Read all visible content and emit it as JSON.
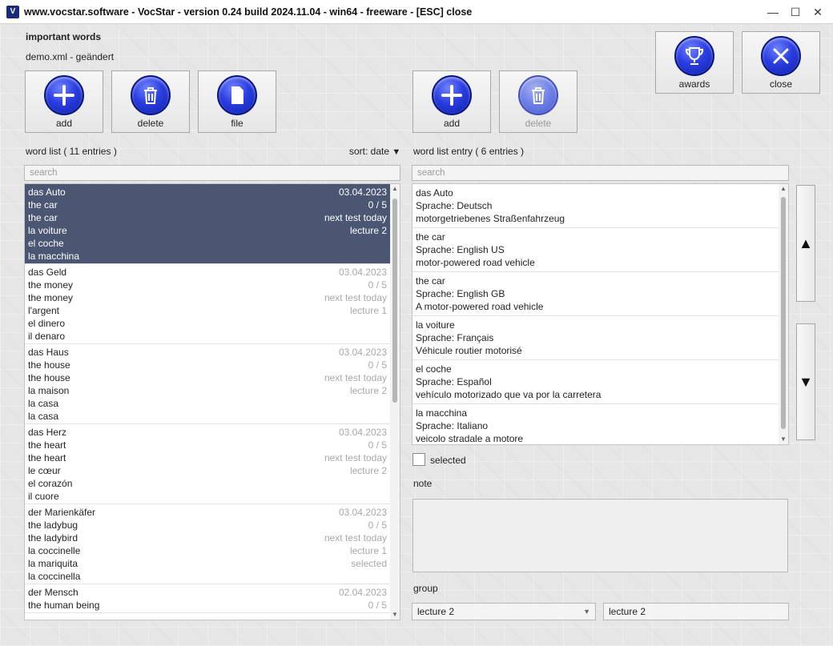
{
  "window": {
    "title": "www.vocstar.software - VocStar - version 0.24 build 2024.11.04 - win64 - freeware - [ESC] close",
    "app_icon": "vocstar-logo",
    "controls": {
      "minimize": "—",
      "maximize": "☐",
      "close": "✕"
    }
  },
  "header": {
    "heading": "important words",
    "file_status": "demo.xml - geändert"
  },
  "toolbar_left": [
    {
      "name": "add-list-button",
      "label": "add",
      "icon": "plus-icon",
      "enabled": true
    },
    {
      "name": "delete-list-button",
      "label": "delete",
      "icon": "trash-icon",
      "enabled": true
    },
    {
      "name": "file-button",
      "label": "file",
      "icon": "file-icon",
      "enabled": true
    }
  ],
  "toolbar_right": [
    {
      "name": "add-entry-button",
      "label": "add",
      "icon": "plus-icon",
      "enabled": true
    },
    {
      "name": "delete-entry-button",
      "label": "delete",
      "icon": "trash-icon",
      "enabled": false
    }
  ],
  "toolbar_top": [
    {
      "name": "awards-button",
      "label": "awards",
      "icon": "trophy-icon"
    },
    {
      "name": "close-button",
      "label": "close",
      "icon": "x-icon"
    }
  ],
  "word_list": {
    "label": "word list ( 11 entries )",
    "sort_label": "sort: date",
    "search_placeholder": "search",
    "items": [
      {
        "selected": true,
        "lines": [
          [
            "das Auto",
            "03.04.2023"
          ],
          [
            "the car",
            "0 / 5"
          ],
          [
            "the car",
            "next test today"
          ],
          [
            "la voiture",
            "lecture 2"
          ],
          [
            "el coche",
            ""
          ],
          [
            "la macchina",
            ""
          ]
        ]
      },
      {
        "selected": false,
        "lines": [
          [
            "das  Geld",
            "03.04.2023"
          ],
          [
            "the  money",
            "0 / 5"
          ],
          [
            "the  money",
            "next test today"
          ],
          [
            "l'argent",
            "lecture 1"
          ],
          [
            "el  dinero",
            ""
          ],
          [
            "il denaro",
            ""
          ]
        ]
      },
      {
        "selected": false,
        "lines": [
          [
            "das  Haus",
            "03.04.2023"
          ],
          [
            "the  house",
            "0 / 5"
          ],
          [
            "the  house",
            "next test today"
          ],
          [
            "la  maison",
            "lecture 2"
          ],
          [
            "la casa",
            ""
          ],
          [
            "la casa",
            ""
          ]
        ]
      },
      {
        "selected": false,
        "lines": [
          [
            "das  Herz",
            "03.04.2023"
          ],
          [
            "the  heart",
            "0 / 5"
          ],
          [
            "the  heart",
            "next test today"
          ],
          [
            "le  cœur",
            "lecture 2"
          ],
          [
            "el  corazón",
            ""
          ],
          [
            "il cuore",
            ""
          ]
        ]
      },
      {
        "selected": false,
        "lines": [
          [
            "der  Marienkäfer",
            "03.04.2023"
          ],
          [
            "the  ladybug",
            "0 / 5"
          ],
          [
            "the  ladybird",
            "next test today"
          ],
          [
            "la  coccinelle",
            "lecture 1"
          ],
          [
            "la  mariquita",
            "selected"
          ],
          [
            "la coccinella",
            ""
          ]
        ]
      },
      {
        "selected": false,
        "lines": [
          [
            "der  Mensch",
            "02.04.2023"
          ],
          [
            "the human being",
            "0 / 5"
          ]
        ]
      }
    ]
  },
  "entry_list": {
    "label": "word list entry ( 6 entries )",
    "search_placeholder": "search",
    "items": [
      {
        "word": "das Auto",
        "lang": "Sprache:  Deutsch",
        "desc": "motorgetriebenes Straßenfahrzeug"
      },
      {
        "word": "the car",
        "lang": "Sprache:  English  US",
        "desc": "motor-powered road vehicle"
      },
      {
        "word": "the car",
        "lang": "Sprache:  English  GB",
        "desc": "A motor-powered road vehicle"
      },
      {
        "word": "la voiture",
        "lang": "Sprache:  Français",
        "desc": "Véhicule routier motorisé"
      },
      {
        "word": "el coche",
        "lang": "Sprache:  Español",
        "desc": "vehículo motorizado que va por la carretera"
      },
      {
        "word": "la macchina",
        "lang": "Sprache:  Italiano",
        "desc": "veicolo stradale a motore"
      }
    ]
  },
  "nav": {
    "up": "▲",
    "down": "▼"
  },
  "details": {
    "selected_label": "selected",
    "selected_checked": false,
    "note_label": "note",
    "note_value": "",
    "group_label": "group",
    "group_combo_value": "lecture 2",
    "group_text_value": "lecture 2"
  },
  "colors": {
    "selection": "#4a5672",
    "orb_blue": "#2a3de0"
  }
}
